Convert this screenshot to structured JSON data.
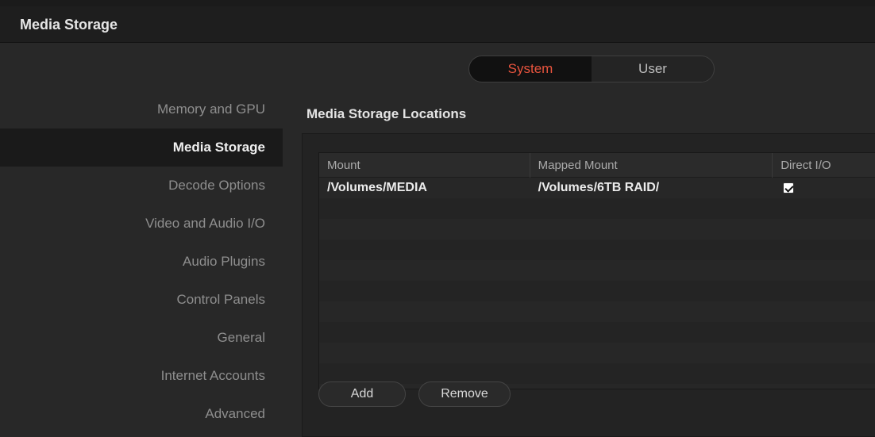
{
  "window": {
    "title": "Media Storage"
  },
  "scope_toggle": {
    "options": [
      "System",
      "User"
    ],
    "selected": "System"
  },
  "sidebar": {
    "items": [
      {
        "label": "Memory and GPU",
        "active": false
      },
      {
        "label": "Media Storage",
        "active": true
      },
      {
        "label": "Decode Options",
        "active": false
      },
      {
        "label": "Video and Audio I/O",
        "active": false
      },
      {
        "label": "Audio Plugins",
        "active": false
      },
      {
        "label": "Control Panels",
        "active": false
      },
      {
        "label": "General",
        "active": false
      },
      {
        "label": "Internet Accounts",
        "active": false
      },
      {
        "label": "Advanced",
        "active": false
      }
    ]
  },
  "main": {
    "section_title": "Media Storage Locations",
    "table": {
      "columns": [
        "Mount",
        "Mapped Mount",
        "Direct I/O"
      ],
      "rows": [
        {
          "mount": "/Volumes/MEDIA",
          "mapped_mount": "/Volumes/6TB RAID/",
          "direct_io": true
        }
      ]
    },
    "buttons": {
      "add_label": "Add",
      "remove_label": "Remove"
    }
  },
  "colors": {
    "accent": "#e8543e",
    "background": "#282828",
    "titlebar": "#1e1e1e"
  }
}
